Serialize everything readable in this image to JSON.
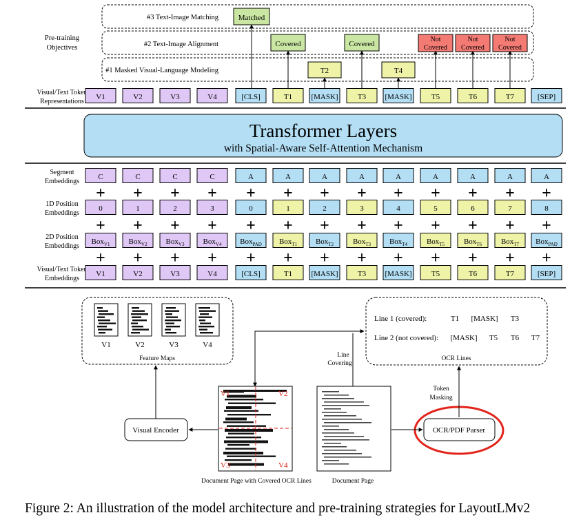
{
  "objectives": {
    "section_label_1": "Pre-training",
    "section_label_2": "Objectives",
    "row3": "#3 Text-Image Matching",
    "row2": "#2 Text-Image Alignment",
    "row1": "#1 Masked Visual-Language Modeling",
    "matched": "Matched",
    "covered": "Covered",
    "not_covered_1": "Not",
    "not_covered_2": "Covered",
    "t2": "T2",
    "t4": "T4"
  },
  "output_tokens": {
    "label_1": "Visual/Text Token",
    "label_2": "Representations",
    "tokens": [
      "V1",
      "V2",
      "V3",
      "V4",
      "[CLS]",
      "T1",
      "[MASK]",
      "T3",
      "[MASK]",
      "T5",
      "T6",
      "T7",
      "[SEP]"
    ]
  },
  "transformer": {
    "title": "Transformer Layers",
    "subtitle": "with Spatial-Aware Self-Attention Mechanism"
  },
  "segment": {
    "label_1": "Segment",
    "label_2": "Embeddings",
    "tokens": [
      "C",
      "C",
      "C",
      "C",
      "A",
      "A",
      "A",
      "A",
      "A",
      "A",
      "A",
      "A",
      "A"
    ]
  },
  "pos1d": {
    "label_1": "1D Position",
    "label_2": "Embeddings",
    "tokens": [
      "0",
      "1",
      "2",
      "3",
      "0",
      "1",
      "2",
      "3",
      "4",
      "5",
      "6",
      "7",
      "8"
    ]
  },
  "pos2d": {
    "label_1": "2D Position",
    "label_2": "Embeddings",
    "base": "Box",
    "subs": [
      "V1",
      "V2",
      "V3",
      "V4",
      "PAD",
      "T1",
      "T2",
      "T3",
      "T4",
      "T5",
      "T6",
      "T7",
      "PAD"
    ]
  },
  "input_tokens": {
    "label_1": "Visual/Text Token",
    "label_2": "Embeddings",
    "tokens": [
      "V1",
      "V2",
      "V3",
      "V4",
      "[CLS]",
      "T1",
      "[MASK]",
      "T3",
      "[MASK]",
      "T5",
      "T6",
      "T7",
      "[SEP]"
    ]
  },
  "plus": "+",
  "feature_maps": {
    "labels": [
      "V1",
      "V2",
      "V3",
      "V4"
    ],
    "caption": "Feature Maps"
  },
  "ocr": {
    "line1_label": "Line 1 (covered):",
    "line1_tokens": [
      "T1",
      "[MASK]",
      "T3"
    ],
    "line2_label": "Line 2 (not covered):",
    "line2_tokens": [
      "[MASK]",
      "T5",
      "T6",
      "T7"
    ],
    "caption": "OCR Lines"
  },
  "pipeline": {
    "line_covering_1": "Line",
    "line_covering_2": "Covering",
    "token_masking_1": "Token",
    "token_masking_2": "Masking",
    "visual_encoder": "Visual Encoder",
    "parser": "OCR/PDF Parser",
    "doc_covered_caption": "Document Page with Covered OCR Lines",
    "doc_caption": "Document Page",
    "quad_labels": [
      "V1",
      "V2",
      "V3",
      "V4"
    ]
  },
  "caption": "Figure 2: An illustration of the model architecture and pre-training strategies for LayoutLMv2",
  "colors": {
    "visual": "#e0c8f6",
    "text": "#eef3a8",
    "special": "#b3def4",
    "matched": "#c9e6a2",
    "covered": "#c9e6a2",
    "not_covered": "#f47a74",
    "transformer": "#b3def4",
    "highlight": "#e2231a"
  }
}
